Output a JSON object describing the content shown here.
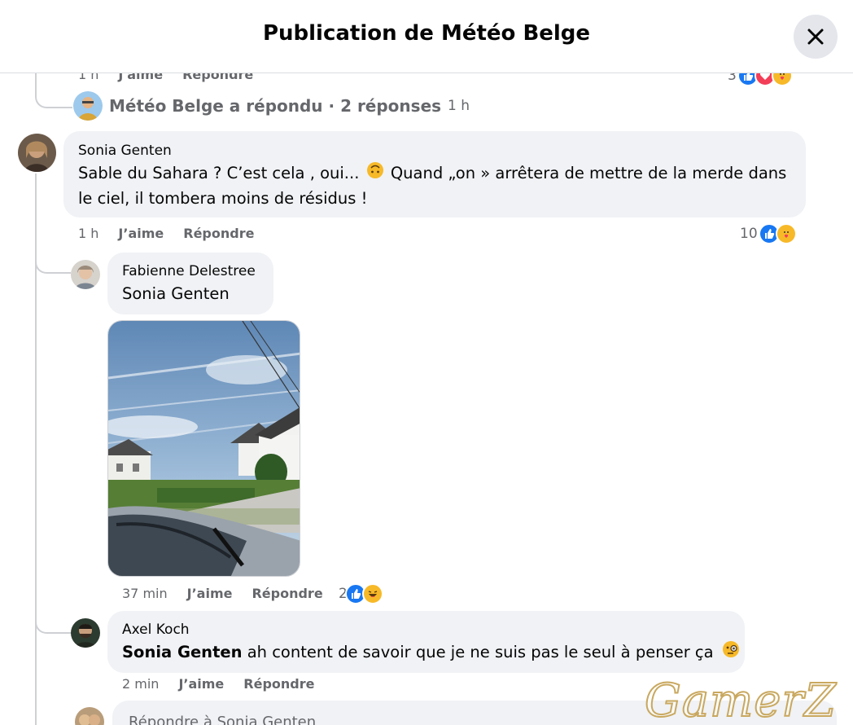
{
  "header": {
    "title": "Publication de Météo Belge"
  },
  "top_partial_meta": {
    "time": "1 h",
    "like": "J'aime",
    "reply": "Répondre",
    "reactions_count": "3"
  },
  "replied_summary": {
    "text": "Météo Belge a répondu · 2 réponses",
    "time": "1 h"
  },
  "comments": [
    {
      "author": "Sonia Genten",
      "text_part1": "Sable du Sahara ? C’est cela , oui...",
      "text_part2": "Quand „on » arrêtera de mettre de la merde dans",
      "text_part3": "le ciel, il tombera moins de résidus !",
      "time": "1 h",
      "like": "J’aime",
      "reply": "Répondre",
      "reactions_count": "10"
    },
    {
      "author": "Fabienne Delestree",
      "mention": "Sonia Genten",
      "time": "37 min",
      "like": "J’aime",
      "reply": "Répondre",
      "reactions_count": "2"
    },
    {
      "author": "Axel Koch",
      "mention": "Sonia Genten",
      "text": "ah content de savoir que je ne suis pas le seul à penser ça",
      "time": "2 min",
      "like": "J’aime",
      "reply": "Répondre"
    }
  ],
  "reply_box": {
    "placeholder": "Répondre à Sonia Genten"
  },
  "watermark": "GamerZ",
  "icons": {
    "close": "close-icon",
    "like": "like-reaction-icon",
    "love": "love-reaction-icon",
    "care": "care-reaction-icon",
    "haha": "haha-reaction-icon",
    "upside_down": "upside-down-face-emoji",
    "monocle": "monocle-face-emoji"
  },
  "colors": {
    "like_blue": "#1877f2",
    "love_red": "#f33e58",
    "emoji_yellow": "#f7b928",
    "bubble_bg": "#f0f2f5",
    "meta_gray": "#65676b"
  }
}
